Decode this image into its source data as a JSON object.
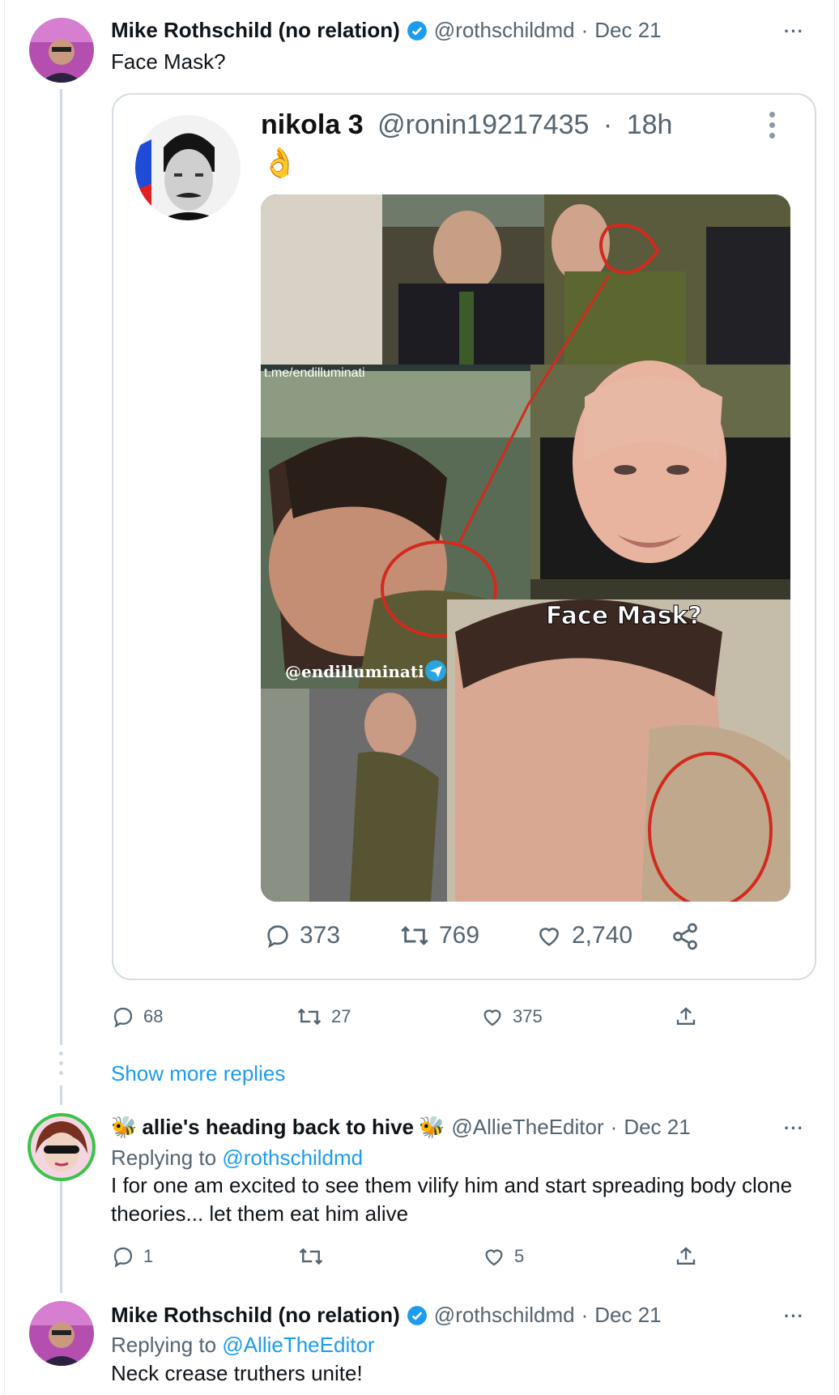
{
  "colors": {
    "link": "#1d9bf0",
    "secondary": "#536471",
    "text": "#0f1419",
    "border": "#d5dde2"
  },
  "tweet1": {
    "name": "Mike Rothschild (no relation)",
    "handle": "@rothschildmd",
    "date": "Dec 21",
    "text": "Face Mask?",
    "more": "···",
    "actions": {
      "replies": "68",
      "retweets": "27",
      "likes": "375"
    }
  },
  "quote": {
    "name": "nikola 3",
    "handle": "@ronin19217435",
    "time": "18h",
    "emoji": "👌",
    "overlay_handle": "@endilluminati",
    "overlay_caption": "Face Mask?",
    "watermark": "t.me/endilluminati",
    "actions": {
      "replies": "373",
      "retweets": "769",
      "likes": "2,740"
    }
  },
  "show_more": "Show more replies",
  "tweet2": {
    "name": "allie's heading back to hive",
    "handle": "@AllieTheEditor",
    "date": "Dec 21",
    "replying_label": "Replying to",
    "replying_to": "@rothschildmd",
    "text_line1": "I for one am excited to see them vilify him and start spreading body clone",
    "text_line2": "theories... let them eat him alive",
    "more": "···",
    "actions": {
      "replies": "1",
      "retweets": "",
      "likes": "5"
    }
  },
  "tweet3": {
    "name": "Mike Rothschild (no relation)",
    "handle": "@rothschildmd",
    "date": "Dec 21",
    "replying_label": "Replying to",
    "replying_to": "@AllieTheEditor",
    "text": "Neck crease truthers unite!",
    "more": "···"
  },
  "icons": [
    "reply-icon",
    "retweet-icon",
    "like-icon",
    "share-icon",
    "verified-icon",
    "more-icon",
    "bee-icon",
    "telegram-icon"
  ]
}
